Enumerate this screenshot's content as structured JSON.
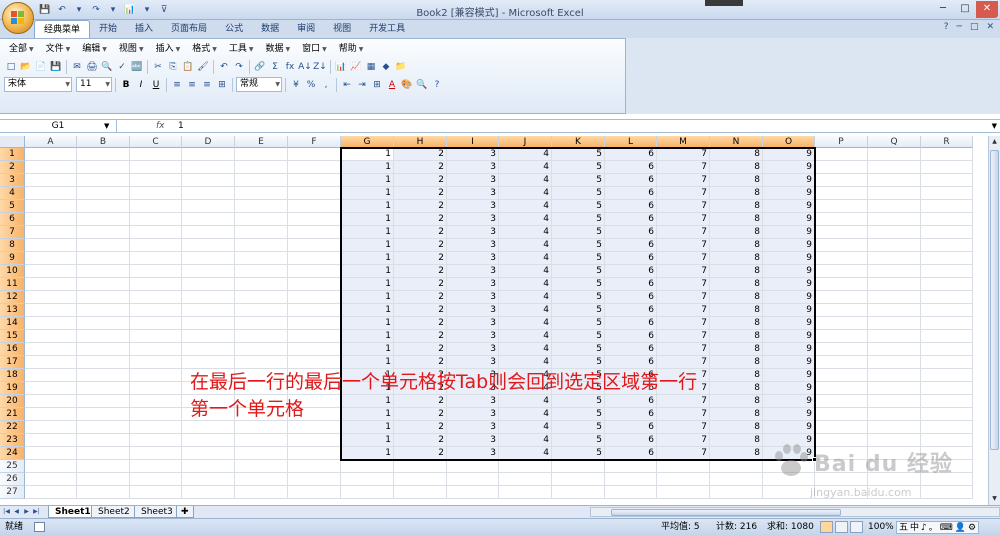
{
  "window": {
    "title": "Book2  [兼容模式]  -  Microsoft Excel",
    "controls": [
      "─",
      "□",
      "✕"
    ]
  },
  "qat": {
    "items": [
      "💾",
      "↶",
      "▾",
      "↷",
      "▾",
      "📊",
      "▾",
      "⊽"
    ]
  },
  "ribbon_tabs": [
    "经典菜单",
    "开始",
    "插入",
    "页面布局",
    "公式",
    "数据",
    "审阅",
    "视图",
    "开发工具"
  ],
  "ribbon_right": {
    "help": "?",
    "min": "─",
    "restore": "□",
    "close": "✕"
  },
  "menu": [
    {
      "label": "全部"
    },
    {
      "label": "文件"
    },
    {
      "label": "编辑"
    },
    {
      "label": "视图"
    },
    {
      "label": "插入"
    },
    {
      "label": "格式"
    },
    {
      "label": "工具"
    },
    {
      "label": "数据"
    },
    {
      "label": "窗口"
    },
    {
      "label": "帮助"
    }
  ],
  "toolbar": {
    "row1": [
      "□",
      "📂",
      "📄",
      "💾",
      "✉",
      "🖨",
      "🔍",
      "✓",
      "🔤",
      "✂",
      "⎘",
      "📋",
      "🖌",
      "↶",
      "↷",
      "🔗",
      "Σ",
      "fx",
      "A↓",
      "Z↓",
      "📊",
      "📈",
      "▦",
      "◆",
      "📁"
    ],
    "font_name": "宋体",
    "font_size": "11",
    "bold": "B",
    "italic": "I",
    "underline": "U",
    "row2_align": [
      "≡",
      "≡",
      "≡",
      "⊞"
    ],
    "number_format": "常规",
    "row2_rest": [
      "¥",
      "%",
      ",",
      "⇤",
      "⇥",
      "⊞",
      "A",
      "🎨",
      "🔍",
      "?"
    ]
  },
  "formula_bar": {
    "name_box": "G1",
    "fx": "fx",
    "value": "1"
  },
  "columns": [
    "A",
    "B",
    "C",
    "D",
    "E",
    "F",
    "G",
    "H",
    "I",
    "J",
    "K",
    "L",
    "M",
    "N",
    "O",
    "P",
    "Q",
    "R"
  ],
  "selected_columns": [
    "G",
    "H",
    "I",
    "J",
    "K",
    "L",
    "M",
    "N",
    "O"
  ],
  "row_numbers": [
    "1",
    "2",
    "3",
    "4",
    "5",
    "6",
    "7",
    "8",
    "9",
    "10",
    "11",
    "12",
    "13",
    "14",
    "15",
    "16",
    "17",
    "18",
    "19",
    "20",
    "21",
    "22",
    "23",
    "24",
    "25",
    "26",
    "27"
  ],
  "selected_rows_count": 24,
  "row_values": [
    "1",
    "2",
    "3",
    "4",
    "5",
    "6",
    "7",
    "8",
    "9"
  ],
  "annotation": {
    "line1": "在最后一行的最后一个单元格按Tab则会回到选定区域第一行",
    "line2": "第一个单元格"
  },
  "sheets": [
    "Sheet1",
    "Sheet2",
    "Sheet3"
  ],
  "status": {
    "ready": "就绪",
    "average": "平均值: 5",
    "count": "计数: 216",
    "sum": "求和: 1080",
    "zoom": "100%",
    "ime": [
      "五",
      "中",
      "♪",
      "。",
      "⌨",
      "👤",
      "⚙"
    ]
  },
  "watermark": {
    "brand": "Bai du 经验",
    "url": "jingyan.baidu.com"
  }
}
